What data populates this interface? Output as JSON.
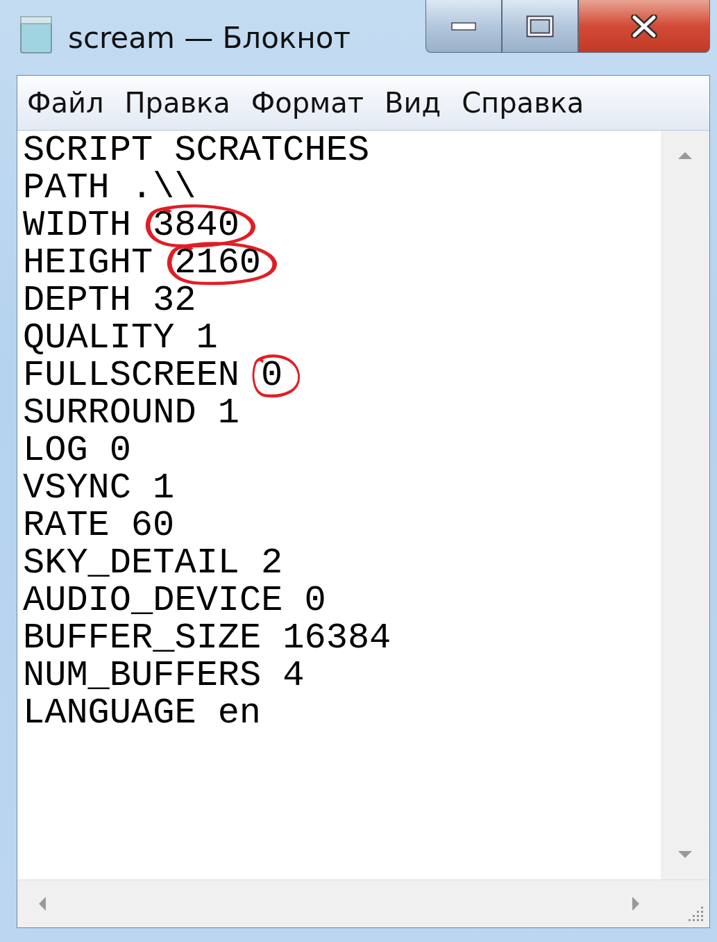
{
  "window": {
    "title": "scream — Блокнот"
  },
  "menu": [
    {
      "label": "Файл"
    },
    {
      "label": "Правка"
    },
    {
      "label": "Формат"
    },
    {
      "label": "Вид"
    },
    {
      "label": "Справка"
    }
  ],
  "lines": [
    {
      "key": "SCRIPT",
      "value": "SCRATCHES",
      "circled": false
    },
    {
      "key": "PATH",
      "value": ".\\\\",
      "circled": false
    },
    {
      "key": "WIDTH",
      "value": "3840",
      "circled": true
    },
    {
      "key": "HEIGHT",
      "value": "2160",
      "circled": true
    },
    {
      "key": "DEPTH",
      "value": "32",
      "circled": false
    },
    {
      "key": "QUALITY",
      "value": "1",
      "circled": false
    },
    {
      "key": "FULLSCREEN",
      "value": "0",
      "circled": true
    },
    {
      "key": "SURROUND",
      "value": "1",
      "circled": false
    },
    {
      "key": "LOG",
      "value": "0",
      "circled": false
    },
    {
      "key": "VSYNC",
      "value": "1",
      "circled": false
    },
    {
      "key": "RATE",
      "value": "60",
      "circled": false
    },
    {
      "key": "SKY_DETAIL",
      "value": "2",
      "circled": false
    },
    {
      "key": "AUDIO_DEVICE",
      "value": "0",
      "circled": false
    },
    {
      "key": "BUFFER_SIZE",
      "value": "16384",
      "circled": false
    },
    {
      "key": "NUM_BUFFERS",
      "value": "4",
      "circled": false
    },
    {
      "key": "LANGUAGE",
      "value": "en",
      "circled": false
    }
  ]
}
